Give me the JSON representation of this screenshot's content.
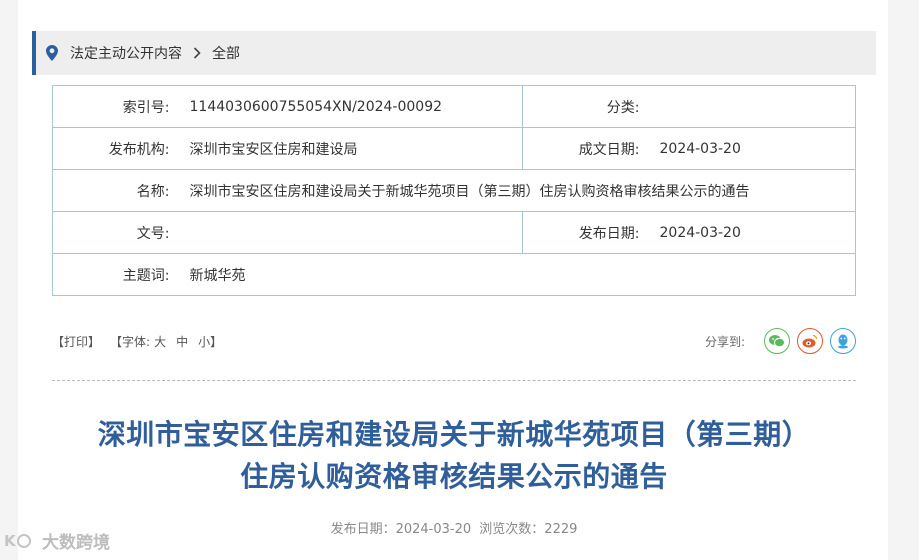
{
  "breadcrumb": {
    "item1": "法定主动公开内容",
    "item2": "全部"
  },
  "meta": {
    "index_label": "索引号:",
    "index_value": "1144030600755054XN/2024-00092",
    "category_label": "分类:",
    "category_value": "",
    "issuer_label": "发布机构:",
    "issuer_value": "深圳市宝安区住房和建设局",
    "written_date_label": "成文日期:",
    "written_date_value": "2024-03-20",
    "name_label": "名称:",
    "name_value": "深圳市宝安区住房和建设局关于新城华苑项目（第三期）住房认购资格审核结果公示的通告",
    "doc_no_label": "文号:",
    "doc_no_value": "",
    "publish_date_label": "发布日期:",
    "publish_date_value": "2024-03-20",
    "subject_label": "主题词:",
    "subject_value": "新城华苑"
  },
  "toolbar": {
    "print": "【打印】",
    "font_prefix": "【字体:",
    "font_large": "大",
    "font_medium": "中",
    "font_small": "小】",
    "share_label": "分享到:"
  },
  "article": {
    "title_line1": "深圳市宝安区住房和建设局关于新城华苑项目（第三期）",
    "title_line2": "住房认购资格审核结果公示的通告",
    "publish_date": "发布日期：2024-03-20",
    "views": "浏览次数：2229"
  },
  "watermark": "大数跨境",
  "colors": {
    "accent": "#2b5f9e",
    "title": "#2f5e9a",
    "wechat": "#5cb85c",
    "weibo": "#e8542c",
    "qq": "#3aa3e3"
  }
}
